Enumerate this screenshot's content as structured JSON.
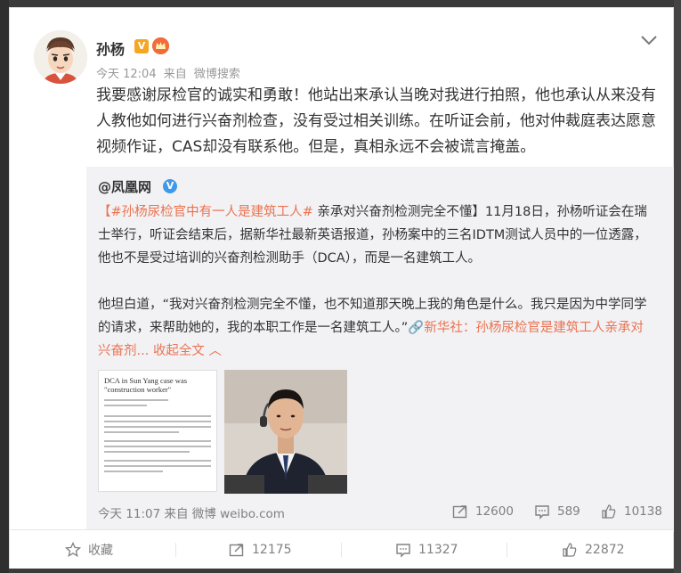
{
  "post": {
    "author": "孙杨",
    "v_badge": "V",
    "time": "今天 12:04",
    "source_prefix": "来自",
    "source": "微博搜索",
    "text": "我要感谢尿检官的诚实和勇敢！他站出来承认当晚对我进行拍照，他也承认从来没有人教他如何进行兴奋剂检查，没有受过相关训练。在听证会前，他对仲裁庭表达愿意视频作证，CAS却没有联系他。但是，真相永远不会被谎言掩盖。"
  },
  "repost": {
    "author": "@凤凰网",
    "hashtag": "【#孙杨尿检官中有一人是建筑工人#",
    "para1_rest": " 亲承对兴奋剂检测完全不懂】11月18日，孙杨听证会在瑞士举行，听证会结束后，据新华社最新英语报道，孙杨案中的三名IDTM测试人员中的一位透露，他也不是受过培训的兴奋剂检测助手（DCA），而是一名建筑工人。",
    "para2": "他坦白道，“我对兴奋剂检测完全不懂，也不知道那天晚上我的角色是什么。我只是因为中学同学的请求，来帮助她的，我的本职工作是一名建筑工人。”",
    "link_text": "🔗新华社：孙杨尿检官是建筑工人亲承对兴奋剂...",
    "collapse_text": "收起全文",
    "thumb1_headline": "DCA in Sun Yang case was \"construction worker\"",
    "time": "今天 11:07",
    "source_prefix": "来自",
    "source": "微博 weibo.com",
    "reposts": "12600",
    "comments": "589",
    "likes": "10138"
  },
  "actions": {
    "favorite": "收藏",
    "repost": "12175",
    "comment": "11327",
    "like": "22872"
  }
}
